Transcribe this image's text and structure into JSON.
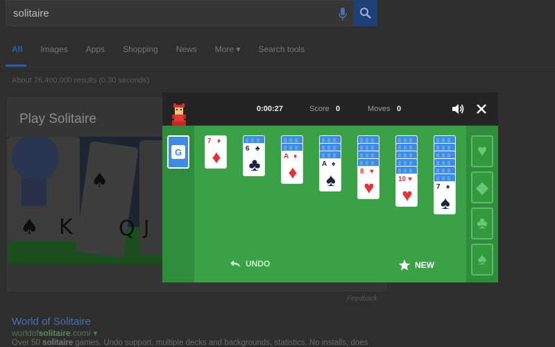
{
  "search": {
    "query": "solitaire"
  },
  "tabs": [
    "All",
    "Images",
    "Apps",
    "Shopping",
    "News",
    "More ▾",
    "Search tools"
  ],
  "result_count": "About 76,400,000 results (0.30 seconds)",
  "card": {
    "title": "Play Solitaire",
    "feedback": "Feedback"
  },
  "result": {
    "title": "World of Solitaire",
    "url_pre": "worldof",
    "url_bold": "solitaire",
    "url_post": ".com/ ▾",
    "snippet_pre": "Over 50 ",
    "snippet_bold": "solitaire",
    "snippet_post": " games. Undo support, multiple decks and backgrounds, statistics. No installs, does"
  },
  "game": {
    "timer": "0:00:27",
    "score_label": "Score",
    "score": "0",
    "moves_label": "Moves",
    "moves": "0",
    "undo_label": "UNDO",
    "new_label": "NEW",
    "stock_logo": "G",
    "foundations": [
      "♥",
      "◆",
      "♣",
      "♠"
    ],
    "tableau": [
      {
        "backs": 0,
        "rank": "7",
        "suit": "♦",
        "color": "red"
      },
      {
        "backs": 1,
        "rank": "6",
        "suit": "♣",
        "color": "blk"
      },
      {
        "backs": 2,
        "rank": "A",
        "suit": "♦",
        "color": "red"
      },
      {
        "backs": 3,
        "rank": "A",
        "suit": "♠",
        "color": "blk"
      },
      {
        "backs": 4,
        "rank": "8",
        "suit": "♥",
        "color": "red"
      },
      {
        "backs": 5,
        "rank": "10",
        "suit": "♥",
        "color": "red"
      },
      {
        "backs": 6,
        "rank": "7",
        "suit": "♠",
        "color": "blk"
      }
    ]
  },
  "colors": {
    "board": "#3aa147",
    "accent": "#3f8be0"
  }
}
